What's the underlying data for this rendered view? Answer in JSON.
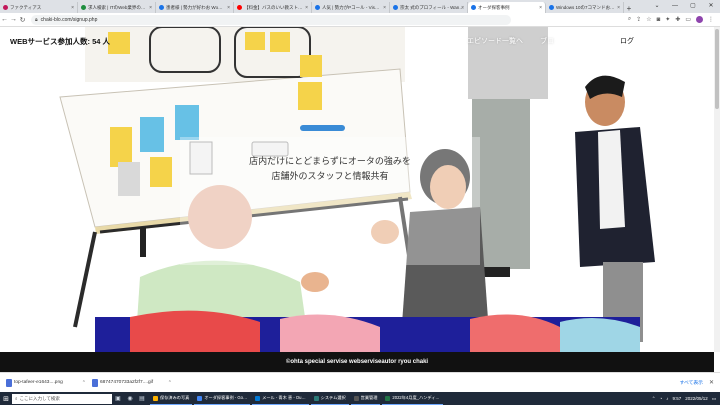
{
  "browser": {
    "tabs": [
      {
        "title": "ファクティアス",
        "color": "#c2185b"
      },
      {
        "title": "求人検索 | ITのWeb業界の…",
        "color": "#1e8e3e"
      },
      {
        "title": "患者様 | 勢力が好わお Wo…",
        "color": "#1a73e8"
      },
      {
        "title": "【料金】バスのいい教スト…",
        "color": "#ff0000"
      },
      {
        "title": "人気 | 勢力がPコール - Vis…",
        "color": "#1a73e8"
      },
      {
        "title": "宗太 式のプロフィール - Wan…",
        "color": "#1a73e8"
      },
      {
        "title": "オーダ探客事例",
        "color": "#1a73e8"
      },
      {
        "title": "Windows 10の7コマンドお…",
        "color": "#1a73e8"
      }
    ],
    "url": "chaki-blo.com/signup.php"
  },
  "site": {
    "members_label": "WEBサービス参加人数: 54 人",
    "nav_episodes": "エピソード一覧へ",
    "nav_blog": "ブロ",
    "nav_login": "ログ",
    "tagline_line1": "店内だけにとどまらずにオータの強みを",
    "tagline_line2": "店舗外のスタッフと情報共有",
    "footer": "©ohta special servise webserviseautor ryou chaki"
  },
  "downloads": {
    "items": [
      {
        "name": "top-tafeer-e1643....png"
      },
      {
        "name": "68747470733a2f2f7....gif"
      }
    ],
    "show_all": "すべて表示"
  },
  "taskbar": {
    "search_placeholder": "ここに入力して検索",
    "apps": [
      {
        "label": "保存済みの写真",
        "color": "#ffb300"
      },
      {
        "label": "オーダ探客事例 - Go…",
        "color": "#4285f4"
      },
      {
        "label": "メール - 青木 恵 - Ou…",
        "color": "#0078d4"
      },
      {
        "label": "システム選択",
        "color": "#2b7a78"
      },
      {
        "label": "営業管理",
        "color": "#555"
      },
      {
        "label": "2022年4月度_ハンディ…",
        "color": "#217346"
      }
    ],
    "time": "9:57",
    "date": "2022/05/12"
  }
}
